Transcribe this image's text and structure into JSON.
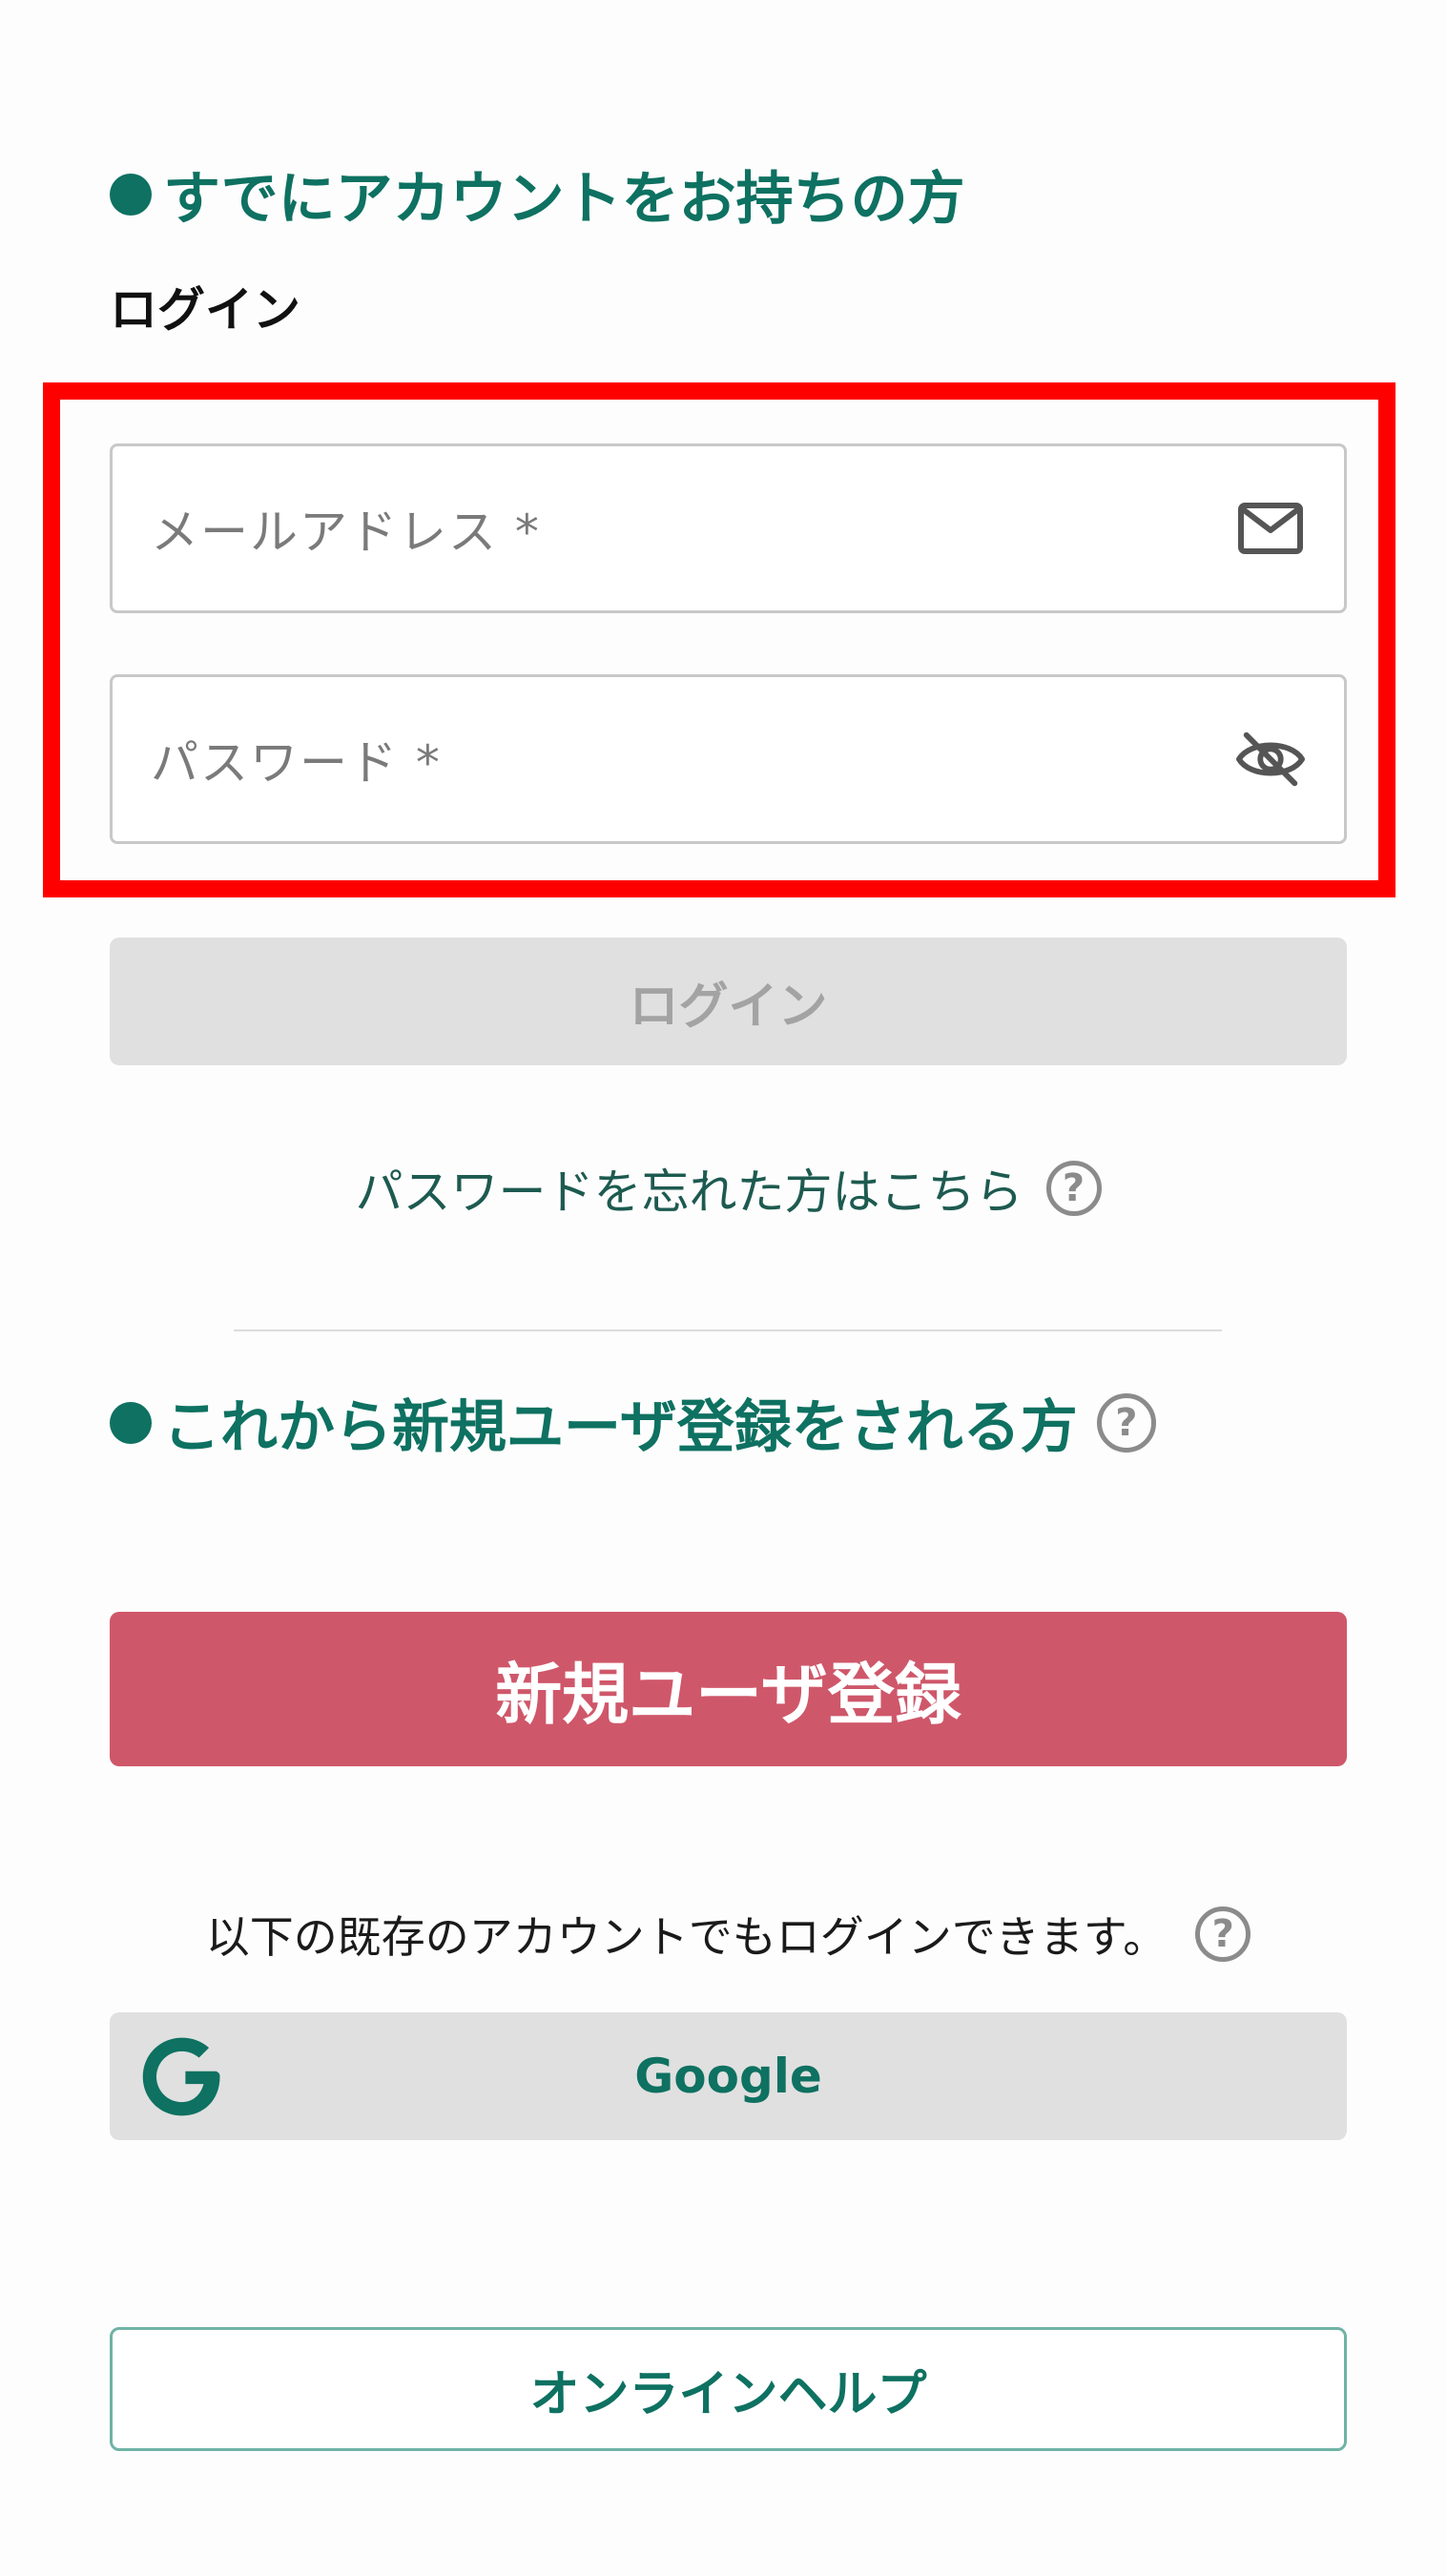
{
  "existing_account": {
    "heading": "すでにアカウントをお持ちの方",
    "login_title": "ログイン"
  },
  "form": {
    "email_label": "メールアドレス *",
    "password_label": "パスワード *",
    "email_icon": "mail-icon",
    "password_icon": "eye-off-icon",
    "login_button": "ログイン"
  },
  "forgot_password": {
    "text": "パスワードを忘れた方はこちら",
    "help_icon": "question-circle-icon"
  },
  "new_user": {
    "heading": "これから新規ユーザ登録をされる方",
    "help_icon": "question-circle-icon",
    "register_button": "新規ユーザ登録"
  },
  "external_login": {
    "text": "以下の既存のアカウントでもログインできます。",
    "help_icon": "question-circle-icon",
    "google_button": "Google",
    "google_icon": "google-g-icon"
  },
  "footer": {
    "online_help_button": "オンラインヘルプ"
  },
  "colors": {
    "brand_green": "#0e7161",
    "register_red": "#cf576a",
    "disabled_gray": "#e0e0e0",
    "highlight_red": "#ff0000"
  }
}
